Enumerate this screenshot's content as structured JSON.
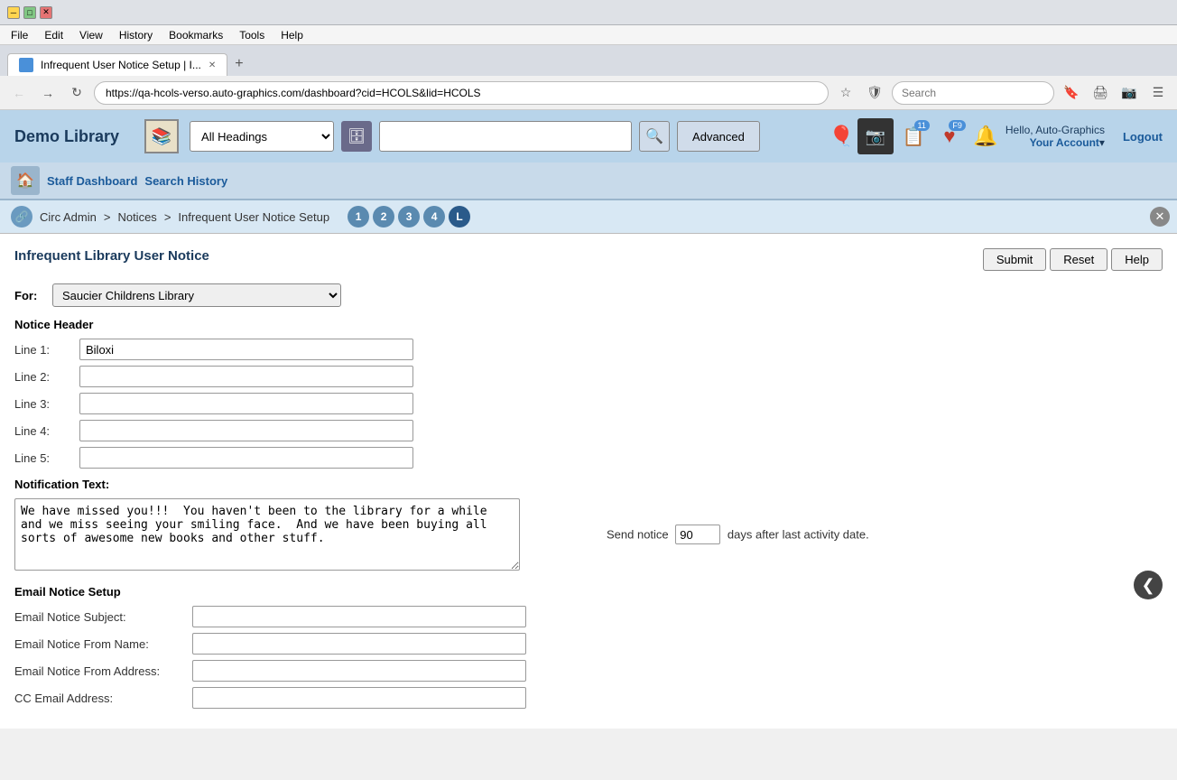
{
  "browser": {
    "title": "Infrequent User Notice Setup | I...",
    "url": "https://qa-hcols-verso.auto-graphics.com/dashboard?cid=HCOLS&lid=HCOLS",
    "search_placeholder": "Search",
    "new_tab": "+"
  },
  "menu": {
    "items": [
      "File",
      "Edit",
      "View",
      "History",
      "Bookmarks",
      "Tools",
      "Help"
    ]
  },
  "app": {
    "library_name": "Demo Library",
    "heading_options": [
      "All Headings"
    ],
    "selected_heading": "All Headings",
    "search_placeholder": "",
    "advanced_label": "Advanced",
    "badge_11": "11",
    "badge_f9": "F9",
    "hello_text": "Hello, Auto-Graphics",
    "your_account": "Your Account",
    "logout": "Logout"
  },
  "nav": {
    "staff_dashboard": "Staff Dashboard",
    "search_history": "Search History"
  },
  "breadcrumb": {
    "circ_admin": "Circ Admin",
    "notices": "Notices",
    "page": "Infrequent User Notice Setup",
    "steps": [
      "1",
      "2",
      "3",
      "4",
      "L"
    ]
  },
  "form": {
    "page_title": "Infrequent Library User Notice",
    "submit_label": "Submit",
    "reset_label": "Reset",
    "help_label": "Help",
    "for_label": "For:",
    "for_value": "Saucier Childrens Library",
    "notice_header_label": "Notice Header",
    "line1_label": "Line 1:",
    "line1_value": "Biloxi",
    "line2_label": "Line 2:",
    "line2_value": "",
    "line3_label": "Line 3:",
    "line3_value": "",
    "line4_label": "Line 4:",
    "line4_value": "",
    "line5_label": "Line 5:",
    "line5_value": "",
    "notification_text_label": "Notification Text:",
    "notification_text_value": "We have missed you!!!  You haven't been to the library for a while and we miss seeing your smiling face.  And we have been buying all sorts of awesome new books and other stuff.",
    "send_notice_prefix": "Send notice",
    "days_value": "90",
    "send_notice_suffix": "days after last activity date.",
    "email_section_label": "Email Notice Setup",
    "email_subject_label": "Email Notice Subject:",
    "email_subject_value": "",
    "email_from_name_label": "Email Notice From Name:",
    "email_from_name_value": "",
    "email_from_address_label": "Email Notice From Address:",
    "email_from_address_value": "",
    "cc_email_label": "CC Email Address:",
    "cc_email_value": ""
  }
}
